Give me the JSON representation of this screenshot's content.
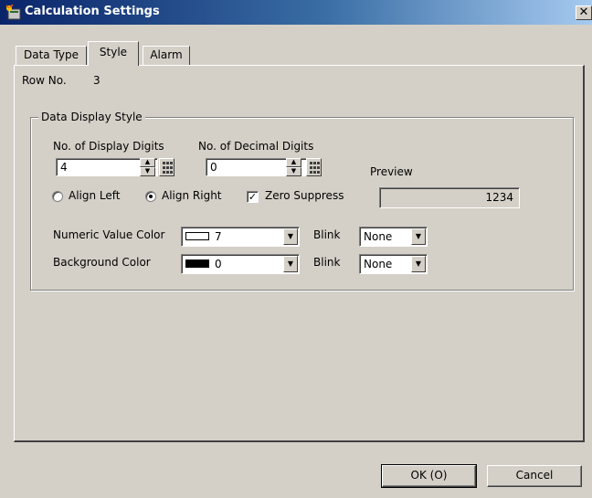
{
  "window": {
    "title": "Calculation Settings"
  },
  "tabs": [
    {
      "label": "Data Type",
      "active": false
    },
    {
      "label": "Style",
      "active": true
    },
    {
      "label": "Alarm",
      "active": false
    }
  ],
  "row": {
    "label": "Row No.",
    "value": "3"
  },
  "data_display_style": {
    "legend": "Data Display Style",
    "display_digits": {
      "label": "No. of Display Digits",
      "value": "4"
    },
    "decimal_digits": {
      "label": "No. of Decimal Digits",
      "value": "0"
    },
    "preview": {
      "label": "Preview",
      "value": "1234"
    },
    "alignment": {
      "left_label": "Align Left",
      "right_label": "Align Right",
      "selected": "Align Right"
    },
    "zero_suppress": {
      "label": "Zero Suppress",
      "checked": true
    },
    "numeric_color": {
      "label": "Numeric Value Color",
      "value": "7",
      "swatch": "#ffffff",
      "blink_label": "Blink",
      "blink_value": "None"
    },
    "background_color": {
      "label": "Background Color",
      "value": "0",
      "swatch": "#000000",
      "blink_label": "Blink",
      "blink_value": "None"
    }
  },
  "buttons": {
    "ok": "OK (O)",
    "cancel": "Cancel"
  },
  "colors": {
    "titlebar_start": "#0a246a",
    "titlebar_end": "#a6caf0",
    "face": "#d4d0c8"
  },
  "icons": {
    "app": "calculator-sparkle-icon",
    "close": "close-icon",
    "spin": "spin-updown-icon",
    "keypad": "keypad-icon",
    "dropdown": "chevron-down-icon"
  }
}
